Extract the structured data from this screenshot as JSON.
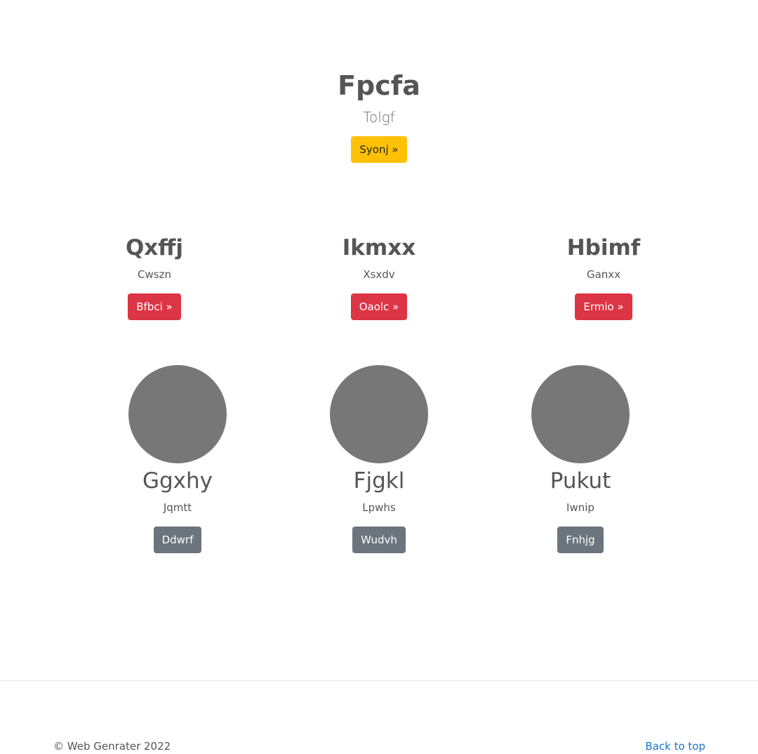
{
  "hero": {
    "title": "Fpcfa",
    "subtitle": "Tolgf",
    "button_label": "Syonj »"
  },
  "features": [
    {
      "title": "Qxffj",
      "text": "Cwszn",
      "button_label": "Bfbci »"
    },
    {
      "title": "Ikmxx",
      "text": "Xsxdv",
      "button_label": "Oaolc »"
    },
    {
      "title": "Hbimf",
      "text": "Ganxx",
      "button_label": "Ermio »"
    }
  ],
  "people": [
    {
      "name": "Ggxhy",
      "text": "Jqmtt",
      "button_label": "Ddwrf"
    },
    {
      "name": "Fjgkl",
      "text": "Lpwhs",
      "button_label": "Wudvh"
    },
    {
      "name": "Pukut",
      "text": "Iwnip",
      "button_label": "Fnhjg"
    }
  ],
  "footer": {
    "copyright": "© Web Genrater 2022",
    "back_to_top": "Back to top"
  },
  "colors": {
    "warning": "#ffc107",
    "danger": "#dc3545",
    "secondary": "#6c757d",
    "avatar": "#777777",
    "link": "#1a73c9"
  }
}
